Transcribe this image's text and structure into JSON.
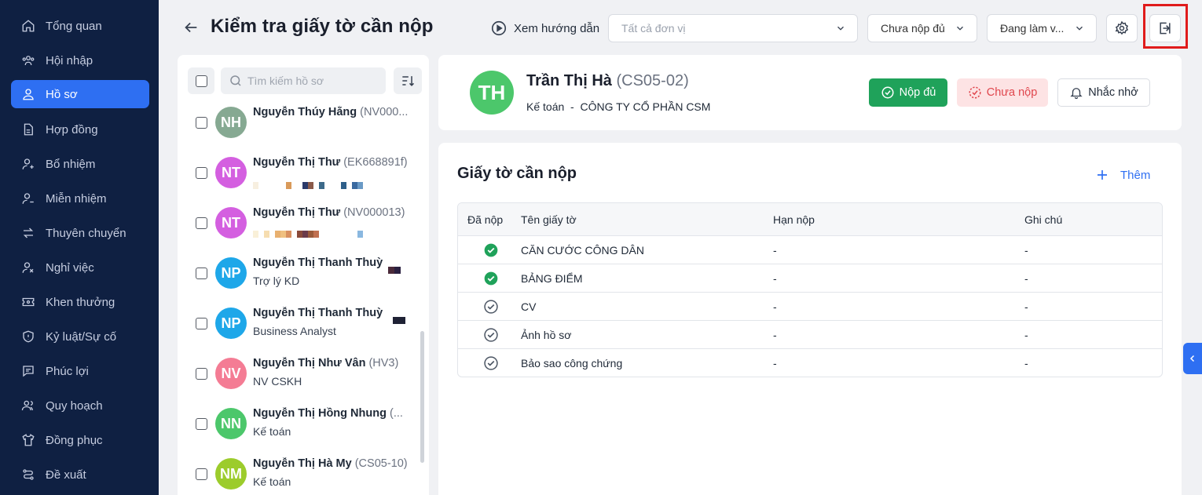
{
  "sidebar": {
    "items": [
      {
        "label": "Tổng quan",
        "icon": "home-icon"
      },
      {
        "label": "Hội nhập",
        "icon": "users-icon"
      },
      {
        "label": "Hồ sơ",
        "icon": "user-icon",
        "active": true
      },
      {
        "label": "Hợp đồng",
        "icon": "document-icon"
      },
      {
        "label": "Bổ nhiệm",
        "icon": "user-plus-icon"
      },
      {
        "label": "Miễn nhiệm",
        "icon": "user-minus-icon"
      },
      {
        "label": "Thuyên chuyển",
        "icon": "transfer-icon"
      },
      {
        "label": "Nghỉ việc",
        "icon": "user-x-icon"
      },
      {
        "label": "Khen thưởng",
        "icon": "ticket-icon"
      },
      {
        "label": "Kỷ luật/Sự cố",
        "icon": "shield-icon"
      },
      {
        "label": "Phúc lợi",
        "icon": "message-icon"
      },
      {
        "label": "Quy hoạch",
        "icon": "user-group-icon"
      },
      {
        "label": "Đồng phục",
        "icon": "shirt-icon"
      },
      {
        "label": "Đề xuất",
        "icon": "route-icon"
      }
    ]
  },
  "header": {
    "title": "Kiểm tra giấy tờ cần nộp",
    "guide_label": "Xem hướng dẫn",
    "unit_placeholder": "Tất cả đơn vị",
    "status_filter": "Chưa nộp đủ",
    "work_filter": "Đang làm v..."
  },
  "list": {
    "search_placeholder": "Tìm kiếm hồ sơ",
    "employees": [
      {
        "initials": "NH",
        "name": "Nguyễn Thúy Hằng",
        "code": "(NV000...",
        "sub": "",
        "color": "#86a992"
      },
      {
        "initials": "NT",
        "name": "Nguyễn Thị Thư",
        "code": "(EK668891f)",
        "sub": "",
        "color": "#d45fe0"
      },
      {
        "initials": "NT",
        "name": "Nguyễn Thị Thư",
        "code": "(NV000013)",
        "sub": "",
        "color": "#d45fe0"
      },
      {
        "initials": "NP",
        "name": "Nguyễn Thị Thanh Thuỳ",
        "code": "",
        "sub": "Trợ lý KD",
        "color": "#1ea7e9"
      },
      {
        "initials": "NP",
        "name": "Nguyễn Thị Thanh Thuỳ",
        "code": "",
        "sub": "Business Analyst",
        "color": "#1ea7e9"
      },
      {
        "initials": "NV",
        "name": "Nguyễn Thị Như Vân",
        "code": "(HV3)",
        "sub": "NV CSKH",
        "color": "#f47c94"
      },
      {
        "initials": "NN",
        "name": "Nguyễn Thị Hồng Nhung",
        "code": "(...",
        "sub": "Kế toán",
        "color": "#4cc76b"
      },
      {
        "initials": "NM",
        "name": "Nguyễn Thị Hà My",
        "code": "(CS05-10)",
        "sub": "Kế toán",
        "color": "#9ccc2c"
      }
    ]
  },
  "profile": {
    "initials": "TH",
    "name": "Trần Thị Hà",
    "code": "(CS05-02)",
    "role": "Kế toán  -  CÔNG TY CỔ PHẦN CSM",
    "btn_full": "Nộp đủ",
    "btn_not": "Chưa nộp",
    "btn_remind": "Nhắc nhở"
  },
  "docs": {
    "title": "Giấy tờ cần nộp",
    "add_label": "Thêm",
    "columns": [
      "Đã nộp",
      "Tên giấy tờ",
      "Hạn nộp",
      "Ghi chú"
    ],
    "rows": [
      {
        "submitted": true,
        "name": "CĂN CƯỚC CÔNG DÂN",
        "deadline": "-",
        "note": "-"
      },
      {
        "submitted": true,
        "name": "BẢNG ĐIỂM",
        "deadline": "-",
        "note": "-"
      },
      {
        "submitted": false,
        "name": "CV",
        "deadline": "-",
        "note": "-"
      },
      {
        "submitted": false,
        "name": "Ảnh hồ sơ",
        "deadline": "-",
        "note": "-"
      },
      {
        "submitted": false,
        "name": "Bảo sao công chứng",
        "deadline": "-",
        "note": "-"
      }
    ]
  },
  "colors": {
    "primary": "#2e6ff2",
    "sidebar": "#0f2042",
    "success": "#1fa25a",
    "danger": "#e0464d"
  }
}
